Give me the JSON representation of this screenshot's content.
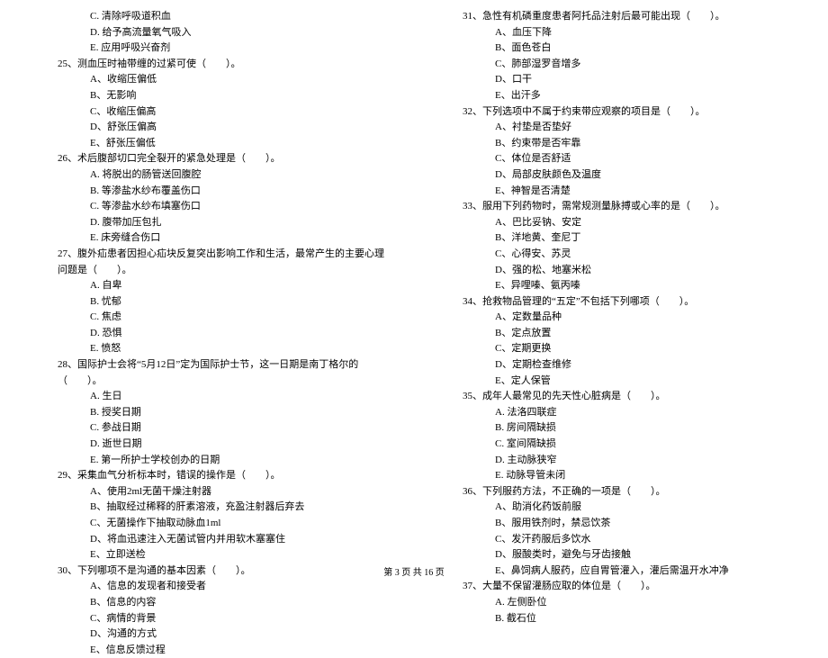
{
  "left": {
    "pre_options": [
      "C. 清除呼吸道积血",
      "D. 给予高流量氧气吸入",
      "E. 应用呼吸兴奋剂"
    ],
    "q25": {
      "text": "25、测血压时袖带缠的过紧可使（　　）。",
      "opts": [
        "A、收缩压偏低",
        "B、无影响",
        "C、收缩压偏高",
        "D、舒张压偏高",
        "E、舒张压偏低"
      ]
    },
    "q26": {
      "text": "26、术后腹部切口完全裂开的紧急处理是（　　）。",
      "opts": [
        "A. 将脱出的肠管送回腹腔",
        "B. 等渗盐水纱布覆盖伤口",
        "C. 等渗盐水纱布填塞伤口",
        "D. 腹带加压包扎",
        "E. 床旁缝合伤口"
      ]
    },
    "q27": {
      "text": "27、腹外疝患者因担心疝块反复突出影响工作和生活，最常产生的主要心理问题是（　　）。",
      "opts": [
        "A. 自卑",
        "B. 忧郁",
        "C. 焦虑",
        "D. 恐惧",
        "E. 愤怒"
      ]
    },
    "q28": {
      "text": "28、国际护士会将“5月12日”定为国际护士节，这一日期是南丁格尔的（　　）。",
      "opts": [
        "A. 生日",
        "B. 授奖日期",
        "C. 参战日期",
        "D. 逝世日期",
        "E. 第一所护士学校创办的日期"
      ]
    },
    "q29": {
      "text": "29、采集血气分析标本时，错误的操作是（　　）。",
      "opts": [
        "A、使用2ml无菌干燥注射器",
        "B、抽取经过稀释的肝素溶液，充盈注射器后弃去",
        "C、无菌操作下抽取动脉血1ml",
        "D、将血迅速注入无菌试管内并用软木塞塞住",
        "E、立即送检"
      ]
    },
    "q30": {
      "text": "30、下列哪项不是沟通的基本因素（　　）。",
      "opts": [
        "A、信息的发现者和接受者",
        "B、信息的内容",
        "C、病情的背景",
        "D、沟通的方式",
        "E、信息反馈过程"
      ]
    }
  },
  "right": {
    "q31": {
      "text": "31、急性有机磷重度患者阿托品注射后最可能出现（　　）。",
      "opts": [
        "A、血压下降",
        "B、面色苍白",
        "C、肺部湿罗音增多",
        "D、口干",
        "E、出汗多"
      ]
    },
    "q32": {
      "text": "32、下列选项中不属于约束带应观察的项目是（　　）。",
      "opts": [
        "A、衬垫是否垫好",
        "B、约束带是否牢靠",
        "C、体位是否舒适",
        "D、局部皮肤颜色及温度",
        "E、神智是否清楚"
      ]
    },
    "q33": {
      "text": "33、服用下列药物时，需常规测量脉搏或心率的是（　　）。",
      "opts": [
        "A、巴比妥钠、安定",
        "B、洋地黄、奎尼丁",
        "C、心得安、苏灵",
        "D、强的松、地塞米松",
        "E、异哩嗪、氨丙嗪"
      ]
    },
    "q34": {
      "text": "34、抢救物品管理的“五定”不包括下列哪项（　　）。",
      "opts": [
        "A、定数量品种",
        "B、定点放置",
        "C、定期更换",
        "D、定期检查维修",
        "E、定人保管"
      ]
    },
    "q35": {
      "text": "35、成年人最常见的先天性心脏病是（　　）。",
      "opts": [
        "A. 法洛四联症",
        "B. 房间隔缺损",
        "C. 室间隔缺损",
        "D. 主动脉狭窄",
        "E. 动脉导管未闭"
      ]
    },
    "q36": {
      "text": "36、下列服药方法，不正确的一项是（　　）。",
      "opts": [
        "A、助消化药饭前服",
        "B、服用铁剂时，禁忌饮茶",
        "C、发汗药服后多饮水",
        "D、服酸类时，避免与牙齿接触",
        "E、鼻饲病人服药，应自胃管灌入，灌后需温开水冲净"
      ]
    },
    "q37": {
      "text": "37、大量不保留灌肠应取的体位是（　　）。",
      "opts": [
        "A. 左侧卧位",
        "B. 截石位"
      ]
    }
  },
  "footer": "第 3 页 共 16 页"
}
